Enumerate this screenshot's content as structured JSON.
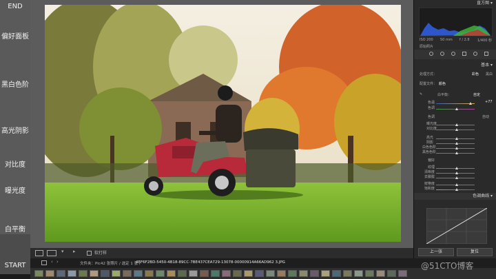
{
  "chapters": [
    "END",
    "偏好面板",
    "黑白色阶",
    "高光阴影",
    "对比度",
    "曝光度",
    "白平衡",
    "START"
  ],
  "toolbar": {
    "softproof": "软打样",
    "prev_label": "上一张",
    "reset_label": "复位"
  },
  "panel": {
    "histogram_title": "直方图",
    "basic_title": "基本",
    "tone_curve_title": "色调曲线",
    "histogram_info": [
      "ISO 200",
      "50 mm",
      "f / 2.8",
      "1/400 秒"
    ],
    "original_photo": "原始照片",
    "treatment_label": "处理方式：",
    "treatment_color": "彩色",
    "treatment_bw": "黑白",
    "profile_label": "配置文件：",
    "profile_value": "颜色",
    "wb_label": "白平衡：",
    "wb_value": "自定",
    "temp_label": "色温",
    "temp_value": "+77",
    "tint_label": "色调",
    "tone_label": "色调",
    "tone_auto": "自动",
    "exposure_label": "曝光度",
    "contrast_label": "对比度",
    "highlights_label": "高光",
    "shadows_label": "阴影",
    "whites_label": "白色色阶",
    "blacks_label": "黑色色阶",
    "presence_label": "偏好",
    "texture_label": "纹理",
    "clarity_label": "清晰度",
    "dehaze_label": "去朦胧",
    "vibrance_label": "鲜艳度",
    "saturation_label": "饱和度"
  },
  "filmstrip": {
    "source": "文件夹：Pic",
    "count": "42 张照片 / 选定 1 张 /",
    "filename": "4EF6F2BD-5450-4B18-89CC-7BE437CEA729-13078-00000914A66AD962 3.JPG"
  },
  "watermark": "@51CTO博客"
}
